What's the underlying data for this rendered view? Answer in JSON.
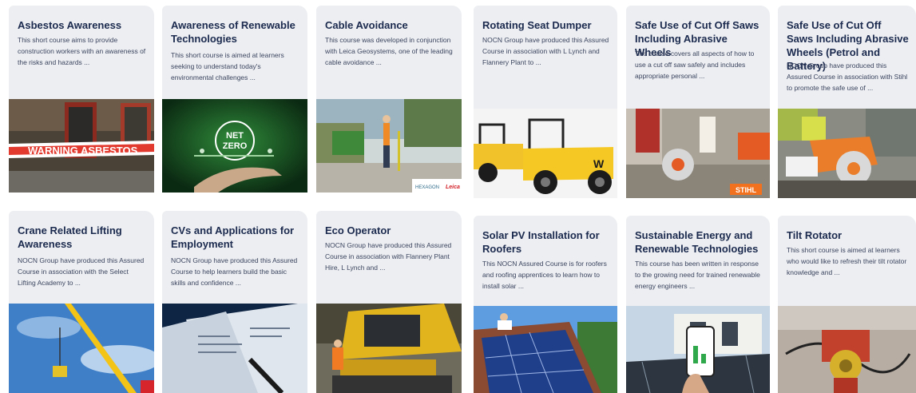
{
  "courses": [
    {
      "title": "Asbestos Awareness",
      "desc": "This short course aims to provide construction workers with an awareness of the risks and hazards ..."
    },
    {
      "title": "Awareness of Renewable Technologies",
      "desc": "This short course is aimed at learners seeking to understand today's environmental challenges ..."
    },
    {
      "title": "Cable Avoidance",
      "desc": "This course was developed in conjunction with Leica Geosystems, one of the leading cable avoidance ..."
    },
    {
      "title": "Rotating Seat Dumper",
      "desc": "NOCN Group have produced this Assured Course in association with L Lynch and Flannery Plant to ..."
    },
    {
      "title": "Safe Use of Cut Off Saws Including Abrasive Wheels",
      "desc": "The course covers all aspects of how to use a cut off saw safely and includes appropriate personal ..."
    },
    {
      "title": "Safe Use of Cut Off Saws Including Abrasive Wheels (Petrol and Battery)",
      "desc": "NOCN Group have produced this Assured Course in association with Stihl to promote the safe use of ..."
    },
    {
      "title": "Crane Related Lifting Awareness",
      "desc": "NOCN Group have produced this Assured Course in association with the Select Lifting Academy to ..."
    },
    {
      "title": "CVs and Applications for Employment",
      "desc": "NOCN Group have produced this Assured Course to help learners build the basic skills and confidence ..."
    },
    {
      "title": "Eco Operator",
      "desc": "NOCN Group have produced this Assured Course in association with Flannery Plant Hire, L Lynch and ..."
    },
    {
      "title": "Solar PV Installation for Roofers",
      "desc": "This NOCN Assured Course is for roofers and roofing apprentices to learn how to install solar ..."
    },
    {
      "title": "Sustainable Energy and Renewable Technologies",
      "desc": "This course has been written in response to the growing need for trained renewable energy engineers ..."
    },
    {
      "title": "Tilt Rotator",
      "desc": "This short course is aimed at learners who would like to refresh their tilt rotator knowledge and ..."
    }
  ],
  "image_text": {
    "warning_tape": "WARNING ASBESTOS",
    "net": "NET",
    "zero": "ZERO",
    "hexagon": "HEXAGON",
    "leica": "Leica",
    "dumper_brand": "W",
    "stihl": "STIHL"
  }
}
